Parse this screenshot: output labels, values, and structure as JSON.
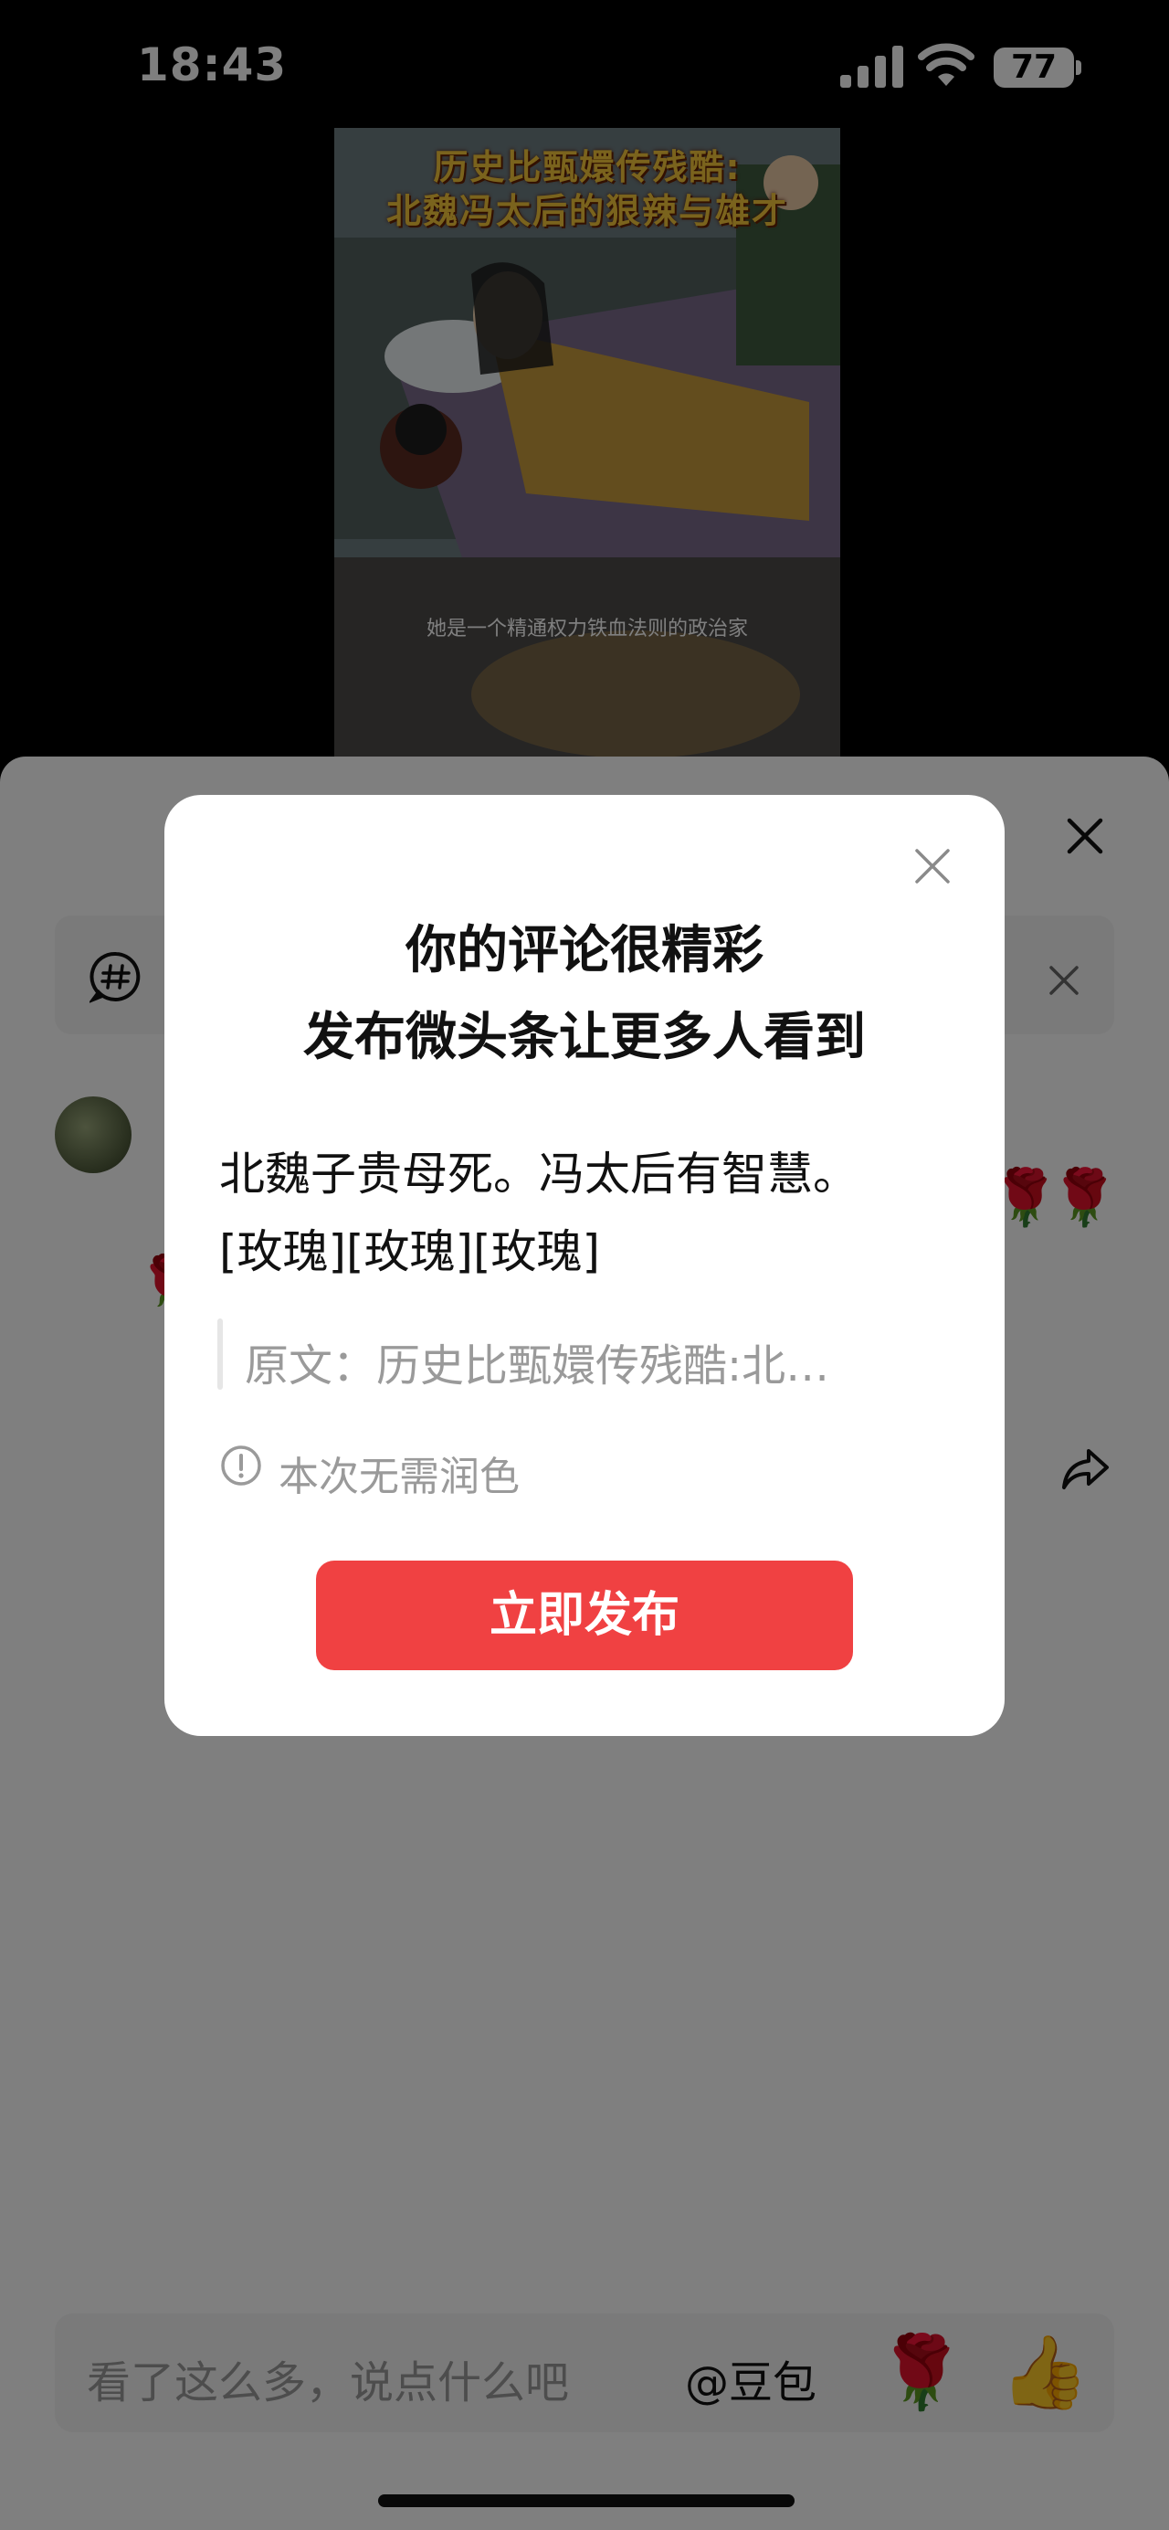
{
  "status_bar": {
    "time": "18:43",
    "battery": "77"
  },
  "video": {
    "title_line1": "历史比甄嬛传残酷:",
    "title_line2": "北魏冯太后的狠辣与雄才",
    "subtitle": "她是一个精通权力铁血法则的政治家"
  },
  "comment": {
    "roses": [
      "🌹",
      "🌹",
      "🌹"
    ]
  },
  "input_bar": {
    "placeholder": "看了这么多，说点什么吧",
    "mention": "@豆包",
    "rose_emoji": "🌹",
    "thumb_emoji": "👍"
  },
  "modal": {
    "title_line1": "你的评论很精彩",
    "title_line2": "发布微头条让更多人看到",
    "comment_line1": "北魏子贵母死。冯太后有智慧。",
    "comment_line2": "[玫瑰][玫瑰][玫瑰]",
    "quote": "原文：历史比甄嬛传残酷:北…",
    "note": "本次无需润色",
    "publish_label": "立即发布"
  },
  "colors": {
    "accent": "#f04142",
    "overlay": "rgba(0,0,0,0.5)"
  }
}
